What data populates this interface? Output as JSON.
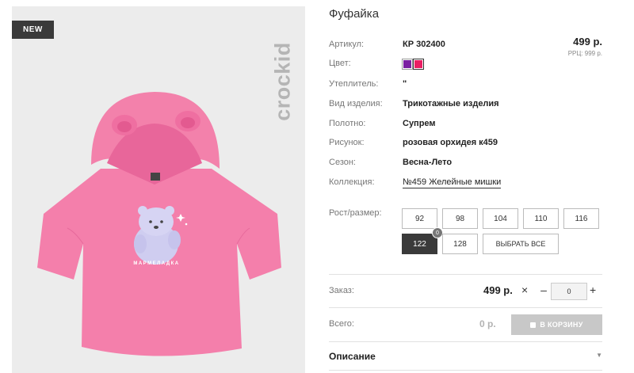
{
  "gallery": {
    "badge": "NEW",
    "brand_logo_text": "crockid",
    "print_caption": "МАРМЕЛАДКА",
    "shirt_color": "#f47fab",
    "bear_color": "#cfcdf0"
  },
  "product": {
    "title": "Фуфайка",
    "price": "499 р.",
    "rrp": "РРЦ: 999 р.",
    "attributes": [
      {
        "label": "Артикул:",
        "value": "КР 302400"
      },
      {
        "label": "Цвет:",
        "value": ""
      },
      {
        "label": "Утеплитель:",
        "value": "\""
      },
      {
        "label": "Вид изделия:",
        "value": "Трикотажные изделия"
      },
      {
        "label": "Полотно:",
        "value": "Супрем"
      },
      {
        "label": "Рисунок:",
        "value": "розовая орхидея к459"
      },
      {
        "label": "Сезон:",
        "value": "Весна-Лето"
      },
      {
        "label": "Коллекция:",
        "value": "№459 Желейные мишки"
      }
    ],
    "colors": [
      "#7b1fa2",
      "#e91e63"
    ]
  },
  "sizes": {
    "label": "Рост/размер:",
    "options": [
      {
        "label": "92",
        "active": false
      },
      {
        "label": "98",
        "active": false
      },
      {
        "label": "104",
        "active": false
      },
      {
        "label": "110",
        "active": false
      },
      {
        "label": "116",
        "active": false
      },
      {
        "label": "122",
        "active": true,
        "stock": "0"
      },
      {
        "label": "128",
        "active": false
      }
    ],
    "select_all": "ВЫБРАТЬ ВСЕ"
  },
  "order": {
    "label": "Заказ:",
    "price": "499 р.",
    "remove": "×",
    "minus": "–",
    "qty": "0",
    "plus": "+"
  },
  "total": {
    "label": "Всего:",
    "value": "0 р.",
    "cart_button": "В КОРЗИНУ"
  },
  "description": {
    "label": "Описание",
    "caret": "▼"
  }
}
